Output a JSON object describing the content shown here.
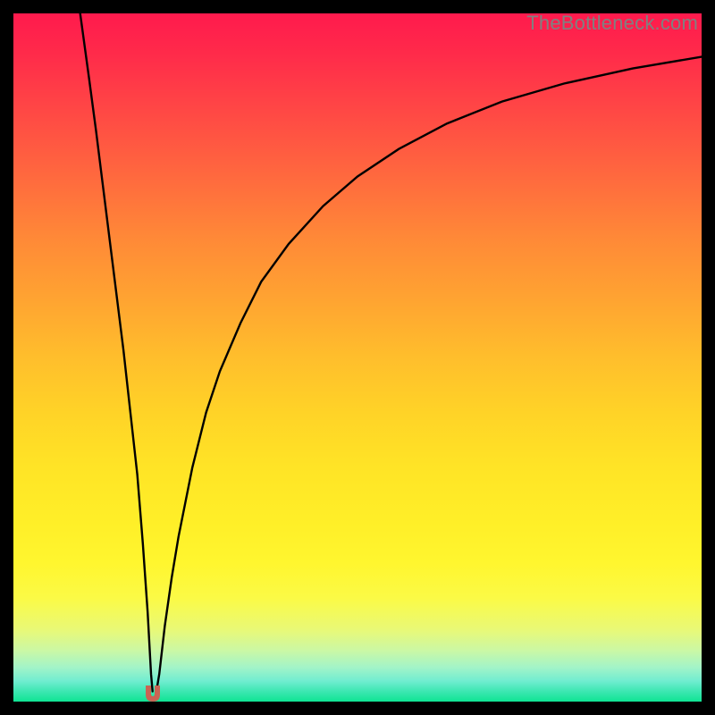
{
  "watermark": "TheBottleneck.com",
  "colors": {
    "curve_stroke": "#000000",
    "marker_fill": "#c96454",
    "frame": "#000000"
  },
  "chart_data": {
    "type": "line",
    "title": "",
    "xlabel": "",
    "ylabel": "",
    "xlim": [
      0,
      100
    ],
    "ylim": [
      0,
      100
    ],
    "grid": false,
    "legend": false,
    "series": [
      {
        "name": "left-branch",
        "x": [
          9.7,
          11,
          12,
          13,
          14,
          15,
          16,
          17,
          18,
          18.8,
          19.5,
          20.0,
          20.22
        ],
        "y": [
          100,
          90.5,
          83,
          75,
          67,
          59,
          51,
          42,
          33,
          23,
          13,
          4,
          1.5
        ]
      },
      {
        "name": "right-branch",
        "x": [
          20.78,
          21.2,
          22,
          23,
          24,
          26,
          28,
          30,
          33,
          36,
          40,
          45,
          50,
          56,
          63,
          71,
          80,
          90,
          100
        ],
        "y": [
          1.5,
          4,
          11,
          18,
          24,
          34,
          42,
          48,
          55,
          61,
          66.5,
          72,
          76.3,
          80.3,
          84,
          87.2,
          89.8,
          92,
          93.7
        ]
      }
    ],
    "marker": {
      "x": 20.3,
      "y": 0.0
    },
    "note": "x and y are percent of the 770×770 plot area; y measured from bottom. Y-values estimated from gradient position (green≈0, red≈100)."
  }
}
